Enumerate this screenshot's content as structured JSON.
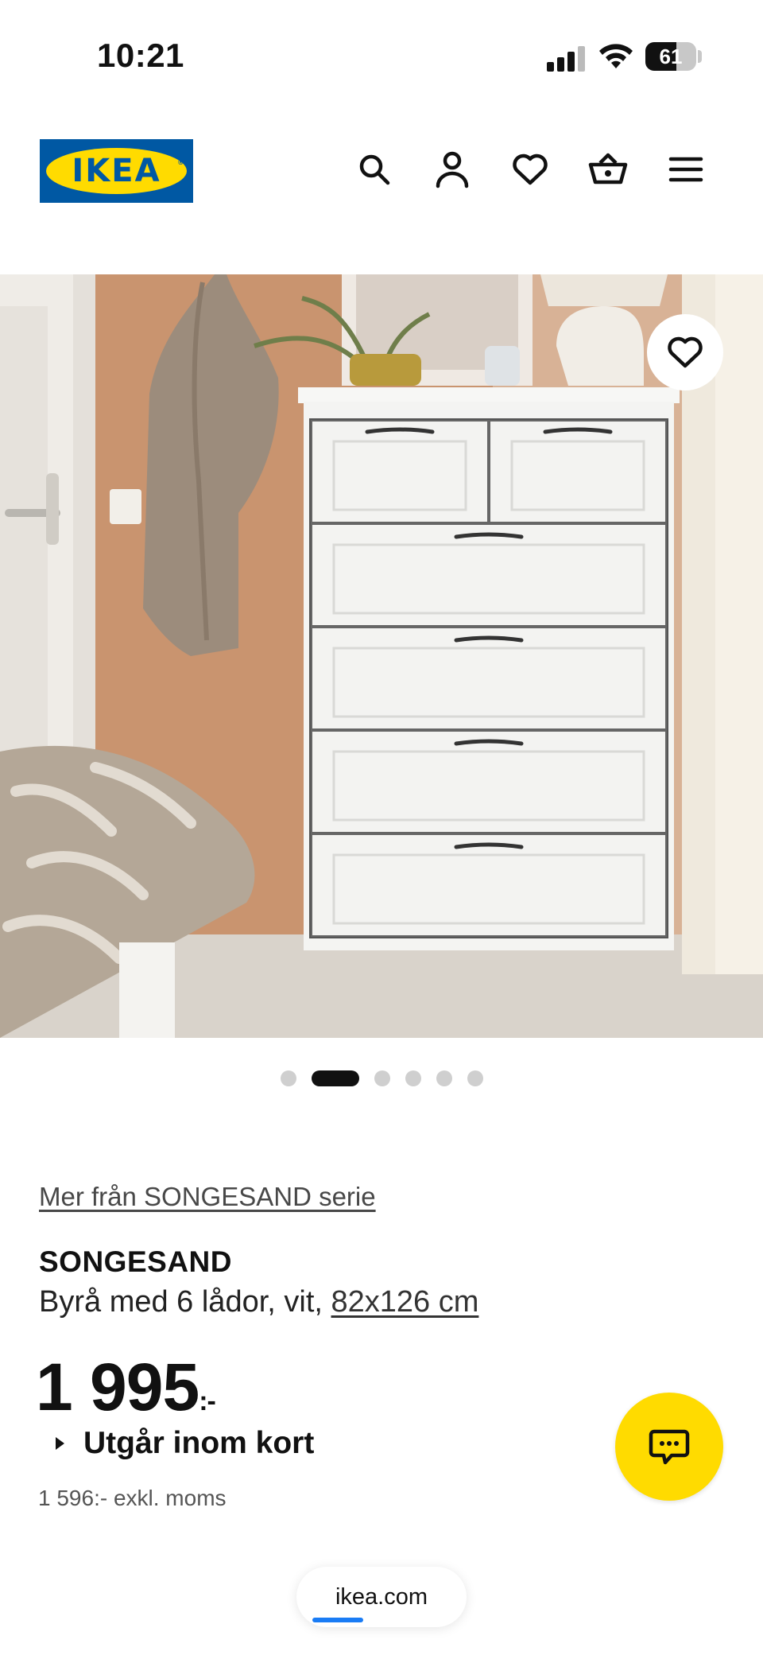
{
  "status_bar": {
    "time": "10:21",
    "battery": "61"
  },
  "brand": {
    "logo_text": "IKEA",
    "logo_mark": "®",
    "colors": {
      "blue": "#0058a3",
      "yellow": "#ffdb00"
    }
  },
  "header": {
    "icons": [
      "search-icon",
      "account-icon",
      "heart-icon",
      "basket-icon",
      "menu-icon"
    ]
  },
  "gallery": {
    "total_images": 6,
    "active_index": 1
  },
  "product": {
    "series_link": "Mer från SONGESAND serie",
    "name": "SONGESAND",
    "description": "Byrå med 6 lådor, vit, ",
    "size_link": "82x126 cm",
    "price_main": "1 995",
    "price_suffix": ":-",
    "availability": "Utgår inom kort",
    "price_ex_vat": "1 596:- exkl. moms"
  },
  "browser": {
    "url": "ikea.com",
    "load_progress": 0.3
  }
}
